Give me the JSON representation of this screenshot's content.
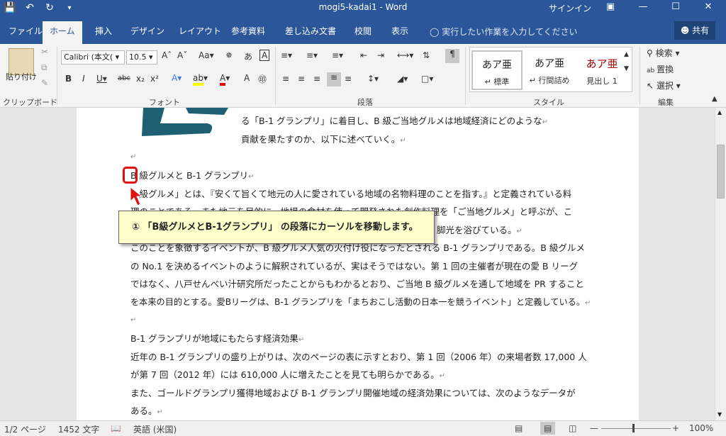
{
  "titlebar": {
    "title": "mogi5-kadai1  -  Word",
    "signin": "サインイン",
    "qat_icons": [
      "save-icon",
      "undo-icon",
      "redo-icon",
      "customize-icon"
    ],
    "window_buttons": [
      "ribbon-display-icon",
      "minimize-icon",
      "maximize-icon",
      "close-icon"
    ]
  },
  "tabs": [
    "ファイル",
    "ホーム",
    "挿入",
    "デザイン",
    "レイアウト",
    "参考資料",
    "差し込み文書",
    "校閲",
    "表示"
  ],
  "active_tab": "ホーム",
  "tellme": "実行したい作業を入力してください",
  "share": "共有",
  "ribbon": {
    "clipboard": {
      "paste": "貼り付け",
      "label": "クリップボード"
    },
    "font": {
      "name": "Calibri (本文(",
      "size": "10.5",
      "label": "フォント",
      "font_color": "#e00000",
      "highlight_color": "#ffff00"
    },
    "paragraph": {
      "label": "段落"
    },
    "styles": {
      "label": "スタイル",
      "items": [
        {
          "sample": "あア亜",
          "name": "↵ 標準"
        },
        {
          "sample": "あア亜",
          "name": "↵ 行間詰め"
        },
        {
          "sample": "あア亜",
          "name": "見出し 1"
        }
      ]
    },
    "editing": {
      "find": "検索",
      "replace": "置換",
      "select": "選択",
      "label": "編集"
    }
  },
  "document": {
    "lines": [
      "る「B-1 グランプリ」に着目し、B 級ご当地グルメは地域経済にどのような",
      "貢献を果たすのか、以下に述べていく。",
      "B 級グルメと B-1 グランプリ",
      "B 級グルメ」とは、『安くて旨くて地元の人に愛されている地域の名物料理のことを指す。』と定義されている料",
      "理のことである。また地元を目的に、地場の食材を使って開発された創作料理を「ご当地グルメ」と呼ぶが、こ",
      "脚光を浴びている。",
      "このことを象徴するイベントが、B 級グルメ人気の火付け役になったとされる B-1 グランプリである。B 級グルメ",
      "の No.1 を決めるイベントのように解釈されているが、実はそうではない。第 1 回の主催者が現在の愛 B リーグ",
      "ではなく、八戸せんべい汁研究所だったことからもわかるとおり、ご当地 B 級グルメを通して地域を PR すること",
      "を本来の目的とする。愛Bリーグは、B-1 グランプリを「まちおこし活動の日本一を競うイベント」と定義している。",
      "B-1 グランプリが地域にもたらす経済効果",
      "近年の B-1 グランプリの盛り上がりは、次のページの表に示すとおり、第 1 回（2006 年）の来場者数 17,000 人",
      "が第 7 回（2012 年）には 610,000 人に増えたことを見ても明らかである。",
      "また、ゴールドグランプリ獲得地域および B-1 グランプリ開催地域の経済効果については、次のようなデータが",
      "ある。"
    ],
    "callout": "① 「B級グルメとB-1グランプリ」 の段落にカーソルを移動します。"
  },
  "status": {
    "page": "1/2 ページ",
    "words": "1452 文字",
    "language": "英語 (米国)",
    "zoom": "100%"
  }
}
